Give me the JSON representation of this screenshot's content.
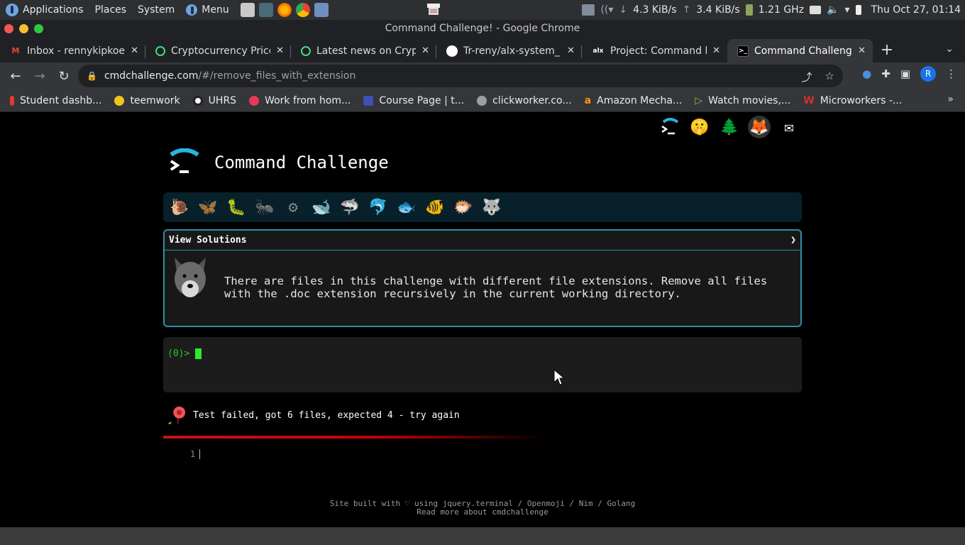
{
  "os_panel": {
    "applications": "Applications",
    "places": "Places",
    "system": "System",
    "menu": "Menu",
    "net_down": "4.3 KiB/s",
    "net_up": "3.4 KiB/s",
    "cpu": "1.21 GHz",
    "clock": "Thu Oct 27, 01:14"
  },
  "window": {
    "title": "Command Challenge! - Google Chrome"
  },
  "tabs": [
    {
      "label": "Inbox - rennykipkoech",
      "icon": "gmail-icon",
      "color": "#ea4335"
    },
    {
      "label": "Cryptocurrency Prices",
      "icon": "coin-icon",
      "color": "#3ddc84"
    },
    {
      "label": "Latest news on Crypto",
      "icon": "coin-icon",
      "color": "#3ddc84"
    },
    {
      "label": "Tr-reny/alx-system_",
      "icon": "github-icon",
      "color": "#ffffff"
    },
    {
      "label": "Project: Command line",
      "icon": "alx-icon",
      "color": "#ffffff"
    },
    {
      "label": "Command Challenge!",
      "icon": "terminal-icon",
      "color": "#ffffff"
    }
  ],
  "address": {
    "host": "cmdchallenge.com",
    "path": "/#/remove_files_with_extension"
  },
  "profile_initial": "R",
  "bookmarks": [
    {
      "label": "Student dashb...",
      "color": "#e53935"
    },
    {
      "label": "teemwork",
      "color": "#f0c419"
    },
    {
      "label": "UHRS",
      "color": "#111111"
    },
    {
      "label": "Work from hom...",
      "color": "#e53957"
    },
    {
      "label": "Course Page | t...",
      "color": "#3f51b5"
    },
    {
      "label": "clickworker.co...",
      "color": "#9aa0a6"
    },
    {
      "label": "Amazon Mecha...",
      "color": "#ff9900"
    },
    {
      "label": "Watch movies,...",
      "color": "#7cc83b"
    },
    {
      "label": "Microworkers -...",
      "color": "#d32f2f"
    }
  ],
  "site": {
    "title": "Command Challenge",
    "view_solutions": "View Solutions",
    "chevron": "❯",
    "description": "There are files in this challenge with different file extensions. Remove all files with the .doc extension recursively in the current working directory.",
    "prompt": "(0)>",
    "result": "Test failed, got 6 files, expected 4 - try again",
    "line_number": "1",
    "footer_line1": "Site built with ♡ using jquery.terminal / Openmoji / Nim / Golang",
    "footer_line2": "Read more about cmdchallenge"
  }
}
